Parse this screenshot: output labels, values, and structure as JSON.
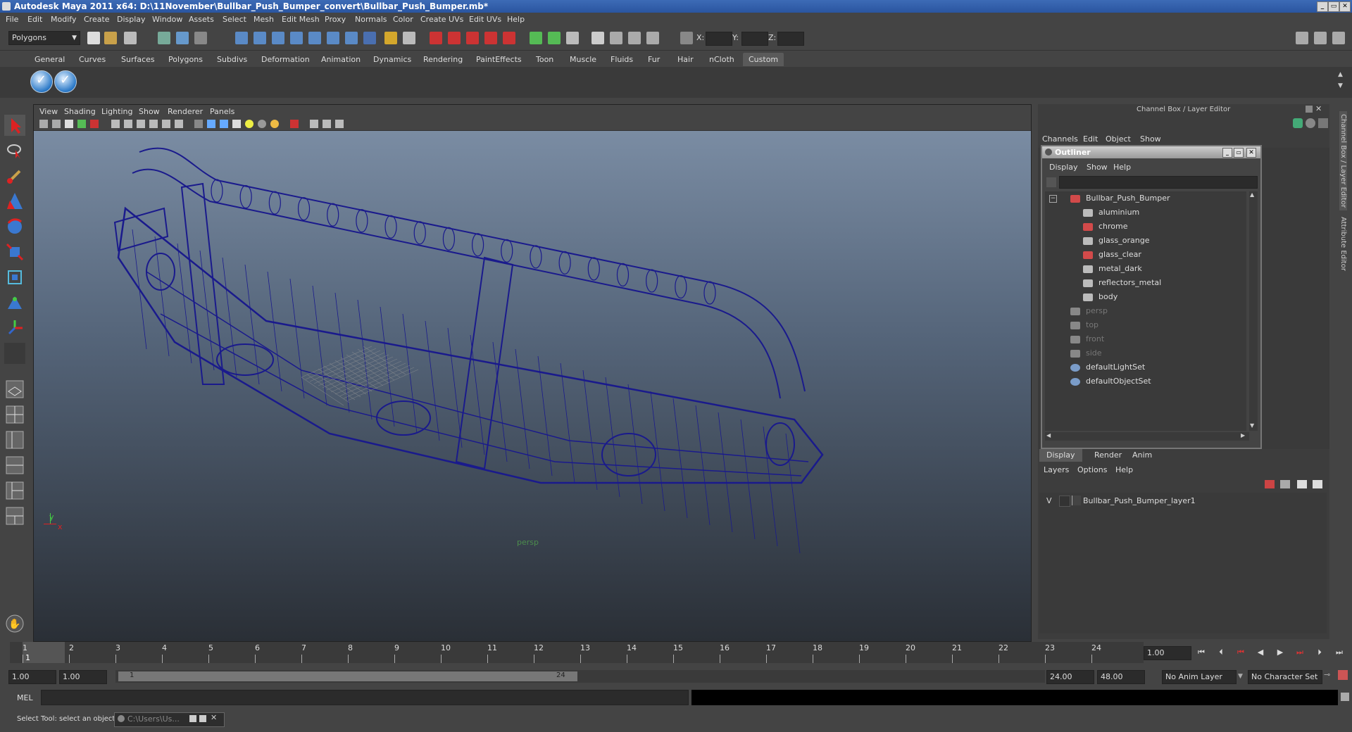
{
  "window": {
    "title": "Autodesk Maya 2011 x64: D:\\11November\\Bullbar_Push_Bumper_convert\\Bullbar_Push_Bumper.mb*"
  },
  "menubar": {
    "items": [
      "File",
      "Edit",
      "Modify",
      "Create",
      "Display",
      "Window",
      "Assets",
      "Select",
      "Mesh",
      "Edit Mesh",
      "Proxy",
      "Normals",
      "Color",
      "Create UVs",
      "Edit UVs",
      "Help"
    ]
  },
  "statusline": {
    "menuset": "Polygons",
    "x_label": "X:",
    "y_label": "Y:",
    "z_label": "Z:"
  },
  "shelf": {
    "tabs": [
      "General",
      "Curves",
      "Surfaces",
      "Polygons",
      "Subdivs",
      "Deformation",
      "Animation",
      "Dynamics",
      "Rendering",
      "PaintEffects",
      "Toon",
      "Muscle",
      "Fluids",
      "Fur",
      "Hair",
      "nCloth",
      "Custom"
    ],
    "active_tab": "Custom"
  },
  "viewport": {
    "menus": [
      "View",
      "Shading",
      "Lighting",
      "Show",
      "Renderer",
      "Panels"
    ],
    "camera_label": "persp",
    "axis_y": "y",
    "axis_x": "x",
    "wire_color": "#1a1a8c"
  },
  "channelbox": {
    "title": "Channel Box / Layer Editor",
    "menus": [
      "Channels",
      "Edit",
      "Object",
      "Show"
    ]
  },
  "outliner": {
    "title": "Outliner",
    "menus": [
      "Display",
      "Show",
      "Help"
    ],
    "items": [
      {
        "label": "Bullbar_Push_Bumper",
        "icon": "group-icon",
        "indent": 0,
        "dim": false
      },
      {
        "label": "aluminium",
        "icon": "mesh-icon",
        "indent": 1,
        "dim": false
      },
      {
        "label": "chrome",
        "icon": "group-icon",
        "indent": 1,
        "dim": false
      },
      {
        "label": "glass_orange",
        "icon": "mesh-icon",
        "indent": 1,
        "dim": false
      },
      {
        "label": "glass_clear",
        "icon": "group-icon",
        "indent": 1,
        "dim": false
      },
      {
        "label": "metal_dark",
        "icon": "mesh-icon",
        "indent": 1,
        "dim": false
      },
      {
        "label": "reflectors_metal",
        "icon": "mesh-icon",
        "indent": 1,
        "dim": false
      },
      {
        "label": "body",
        "icon": "mesh-icon",
        "indent": 1,
        "dim": false
      },
      {
        "label": "persp",
        "icon": "camera-icon",
        "indent": 0,
        "dim": true
      },
      {
        "label": "top",
        "icon": "camera-icon",
        "indent": 0,
        "dim": true
      },
      {
        "label": "front",
        "icon": "camera-icon",
        "indent": 0,
        "dim": true
      },
      {
        "label": "side",
        "icon": "camera-icon",
        "indent": 0,
        "dim": true
      },
      {
        "label": "defaultLightSet",
        "icon": "set-icon",
        "indent": 0,
        "dim": false
      },
      {
        "label": "defaultObjectSet",
        "icon": "set-icon",
        "indent": 0,
        "dim": false
      }
    ]
  },
  "layereditor": {
    "tabs": [
      "Display",
      "Render",
      "Anim"
    ],
    "menus": [
      "Layers",
      "Options",
      "Help"
    ],
    "layer": {
      "visible": "V",
      "name": "Bullbar_Push_Bumper_layer1"
    }
  },
  "sidetabs": {
    "channel": "Channel Box / Layer Editor",
    "attribute": "Attribute Editor"
  },
  "timeline": {
    "ticks": [
      "1",
      "2",
      "3",
      "4",
      "5",
      "6",
      "7",
      "8",
      "9",
      "10",
      "11",
      "12",
      "13",
      "14",
      "15",
      "16",
      "17",
      "18",
      "19",
      "20",
      "21",
      "22",
      "23",
      "24"
    ],
    "current_marker": "1",
    "current_time": "1.00"
  },
  "range": {
    "start": "1.00",
    "playback_start": "1.00",
    "slider_start": "1",
    "slider_end": "24",
    "playback_end": "24.00",
    "end": "48.00",
    "anim_layer": "No Anim Layer",
    "character_set": "No Character Set"
  },
  "command": {
    "label": "MEL"
  },
  "help": {
    "text": "Select Tool: select an object",
    "taskbar_item": "C:\\Users\\Us..."
  }
}
